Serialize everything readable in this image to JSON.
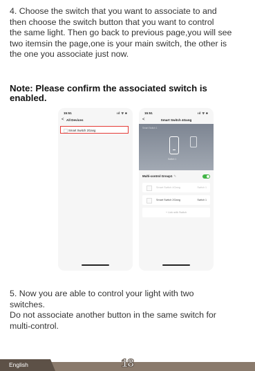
{
  "step4_text": "4. Choose the switch that you want to associate to and\nthen choose the switch button that you want to control\nthe same light. Then go back to previous page,you will see\ntwo itemsin the page,one is your main switch, the other is\nthe one you associate just now.",
  "note_text": "Note: Please confirm the associated switch is\nenabled.",
  "step5_text": "5. Now you are able to control your light with two\nswitches.\nDo not associate another button in the same switch for\nmulti-control.",
  "phone_left": {
    "time": "15:51",
    "status": "ııl ᯤ ■",
    "back": "<",
    "title": "All Devices",
    "device_label": "Smart Switch 2Gang"
  },
  "phone_right": {
    "time": "15:51",
    "status": "ııl ᯤ ■",
    "back": "<",
    "title": "Smart Switch 4Gang",
    "hero_small": "Smart Switch 1",
    "switch_label": "Switch 1",
    "group_label": "Multi-control Group1",
    "edit_glyph": "✎",
    "rows": [
      {
        "name": "Smart Switch 4Gang",
        "switch": "Switch 1",
        "dim": true
      },
      {
        "name": "Smart Switch 2Gang",
        "switch": "Switch 1",
        "dim": false
      }
    ],
    "link_label": "+  Link with Switch"
  },
  "footer": {
    "language": "English",
    "page_number": "18",
    "bar_color": "#8a7a6c",
    "tab_color": "#5d5147"
  }
}
